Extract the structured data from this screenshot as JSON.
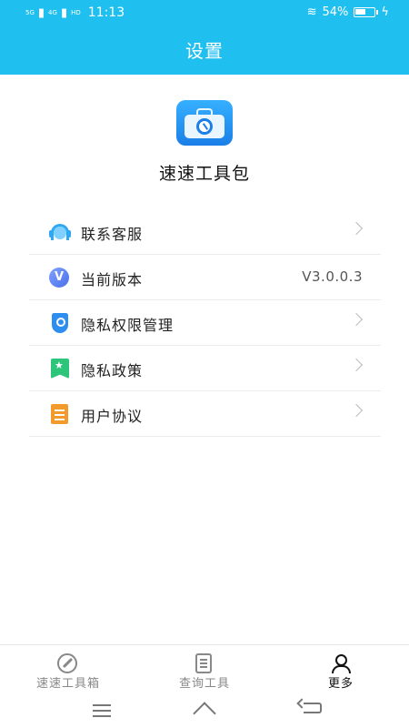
{
  "status_bar": {
    "signal1": "5G",
    "signal2": "4G",
    "hd": "HD",
    "time": "11:13",
    "battery": "54%"
  },
  "header": {
    "title": "设置"
  },
  "app": {
    "name": "速速工具包",
    "icon": "toolbox-icon"
  },
  "menu": {
    "items": [
      {
        "label": "联系客服",
        "icon": "headset-icon",
        "chevron": true
      },
      {
        "label": "当前版本",
        "icon": "version-icon",
        "value": "V3.0.0.3"
      },
      {
        "label": "隐私权限管理",
        "icon": "shield-key-icon",
        "chevron": true
      },
      {
        "label": "隐私政策",
        "icon": "bookmark-star-icon",
        "chevron": true
      },
      {
        "label": "用户协议",
        "icon": "document-icon",
        "chevron": true
      }
    ]
  },
  "tabs": [
    {
      "label": "速速工具箱",
      "icon": "wrench-icon",
      "active": false
    },
    {
      "label": "查询工具",
      "icon": "list-icon",
      "active": false
    },
    {
      "label": "更多",
      "icon": "user-icon",
      "active": true
    }
  ],
  "colors": {
    "accent": "#1fc0f0",
    "text": "#222222",
    "muted": "#888888"
  }
}
